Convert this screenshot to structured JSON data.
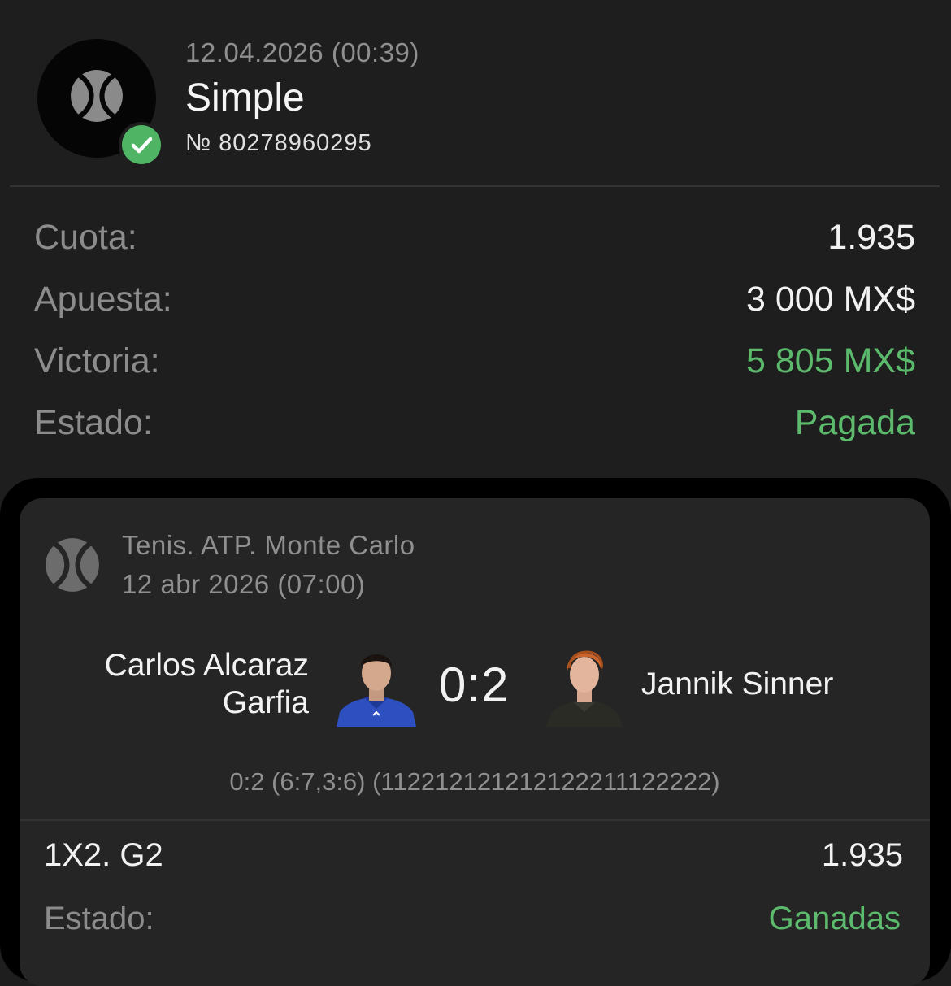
{
  "bet": {
    "datetime": "12.04.2026 (00:39)",
    "type": "Simple",
    "number": "№ 80278960295",
    "status_icon": "check-icon"
  },
  "summary": [
    {
      "label": "Cuota:",
      "value": "1.935"
    },
    {
      "label": "Apuesta:",
      "value": "3 000 MX$"
    },
    {
      "label": "Victoria:",
      "value": "5 805 MX$"
    },
    {
      "label": "Estado:",
      "value": "Pagada"
    }
  ],
  "event": {
    "sport_icon": "tennis-ball-icon",
    "league": "Tenis. ATP. Monte Carlo",
    "date": "12 abr 2026 (07:00)",
    "team1": {
      "line1": "Carlos Alcaraz",
      "line2": "Garfia"
    },
    "team2": "Jannik Sinner",
    "score": "0:2",
    "detail": "0:2 (6:7,3:6) (112212121212122211122222)",
    "market": "1X2. G2",
    "market_odds": "1.935",
    "status_label": "Estado:",
    "status_value": "Ganadas"
  },
  "colors": {
    "background": "#1e1e1e",
    "card": "#252525",
    "accent_green": "#5cba6c",
    "muted_text": "#8c8c8c"
  }
}
